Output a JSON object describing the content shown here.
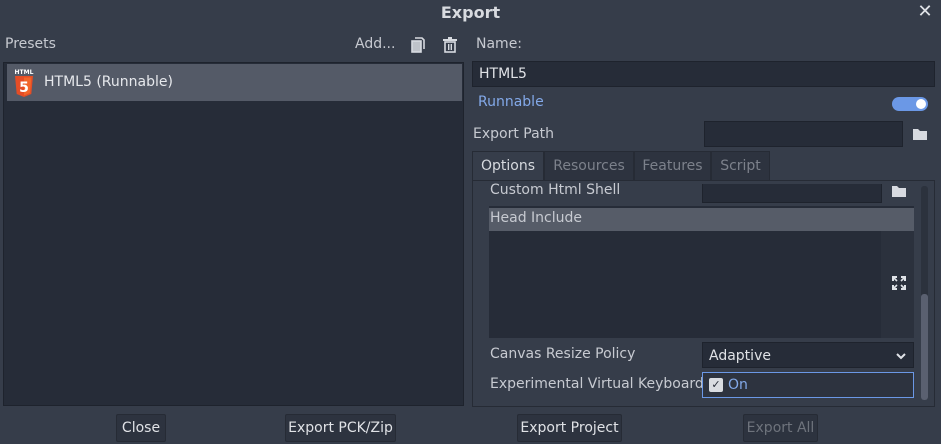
{
  "window": {
    "title": "Export"
  },
  "presets": {
    "label": "Presets",
    "add_label": "Add...",
    "items": [
      {
        "label": "HTML5 (Runnable)",
        "icon_text": "HTML",
        "icon_glyph": "5"
      }
    ]
  },
  "details": {
    "name_label": "Name:",
    "name_value": "HTML5",
    "runnable_label": "Runnable",
    "runnable_on": true,
    "export_path_label": "Export Path",
    "export_path_value": ""
  },
  "tabs": [
    {
      "label": "Options",
      "active": true
    },
    {
      "label": "Resources",
      "active": false
    },
    {
      "label": "Features",
      "active": false
    },
    {
      "label": "Script",
      "active": false
    }
  ],
  "options": {
    "custom_html_shell_label": "Custom Html Shell",
    "head_include_label": "Head Include",
    "canvas_resize_policy_label": "Canvas Resize Policy",
    "canvas_resize_policy_value": "Adaptive",
    "virtual_keyboard_label": "Experimental Virtual Keyboard",
    "virtual_keyboard_value": "On"
  },
  "buttons": {
    "close": "Close",
    "export_pck": "Export PCK/Zip",
    "export_project": "Export Project",
    "export_all": "Export All"
  },
  "colors": {
    "background": "#363d4a",
    "field": "#262c38",
    "accent": "#6b98e6",
    "accent_text": "#83a9e9",
    "html5_orange": "#e44d26"
  },
  "icons": {
    "close": "close-icon",
    "duplicate": "duplicate-icon",
    "delete": "trash-icon",
    "folder": "folder-icon",
    "expand": "expand-icon",
    "chevron": "chevron-down-icon",
    "checkmark": "checkmark-icon"
  }
}
